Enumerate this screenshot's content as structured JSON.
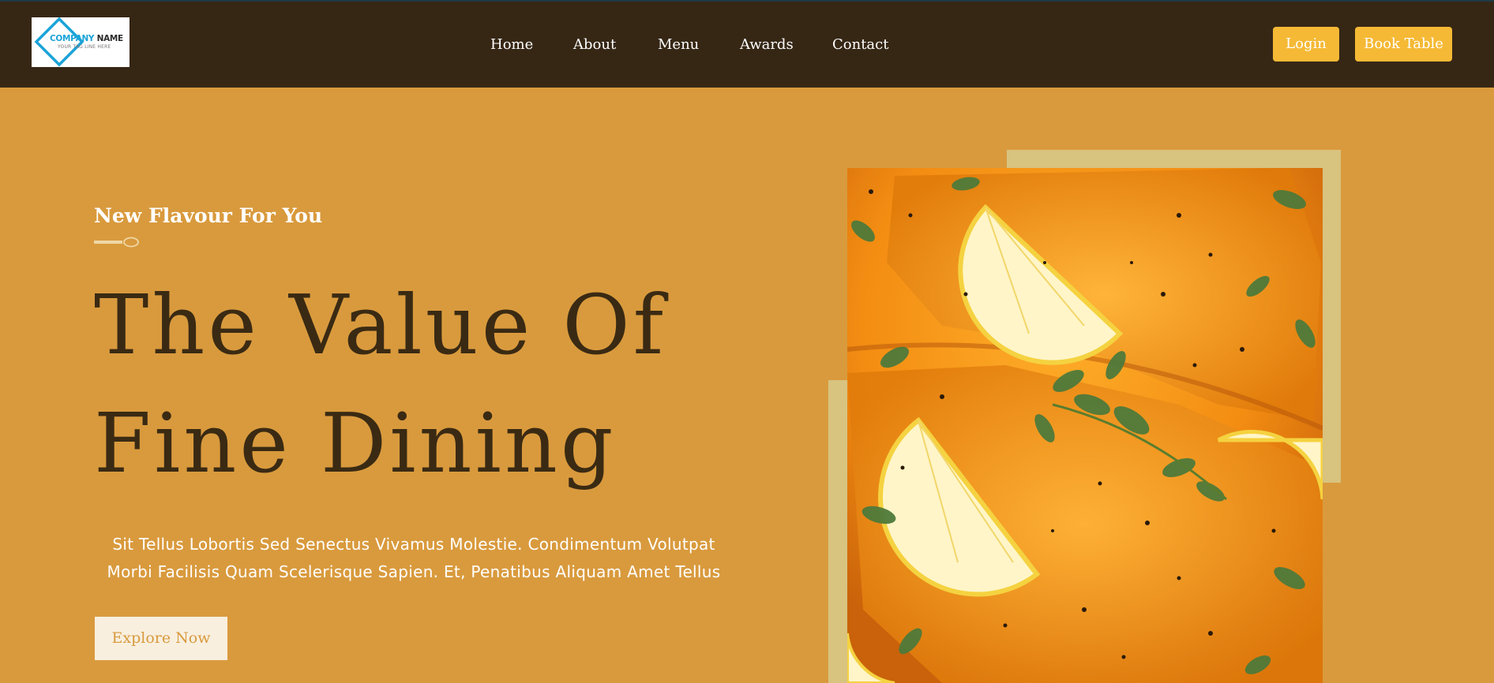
{
  "header": {
    "logo": {
      "name_part1": "COMPANY",
      "name_part2": "NAME",
      "tagline": "YOUR TAG LINE HERE",
      "accent_color": "#1aa3d8"
    },
    "nav": [
      "Home",
      "About",
      "Menu",
      "Awards",
      "Contact"
    ],
    "login_label": "Login",
    "book_label": "Book Table",
    "button_color": "#f5b935",
    "background_color": "#362715"
  },
  "hero": {
    "subtitle": "New Flavour For You",
    "title_line1": "The Value Of",
    "title_line2": "Fine Dining",
    "description": "Sit Tellus Lobortis Sed Senectus Vivamus Molestie. Condimentum Volutpat Morbi Facilisis Quam Scelerisque Sapien. Et, Penatibus Aliquam Amet Tellus",
    "cta_label": "Explore Now",
    "background_color": "#d99a3d",
    "image": "salmon-with-lemon-and-herbs"
  }
}
